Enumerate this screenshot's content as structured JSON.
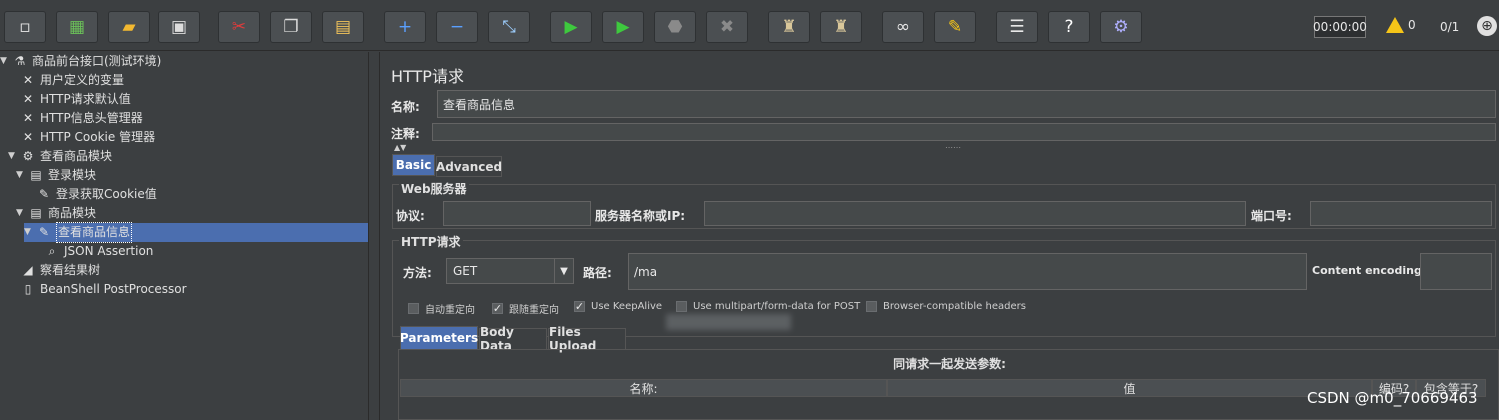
{
  "toolbar": {
    "buttons": [
      {
        "name": "new-icon",
        "glyph": "▫",
        "color": "#e8e8e8"
      },
      {
        "name": "templates-icon",
        "glyph": "▦",
        "color": "#6bbf59"
      },
      {
        "name": "open-icon",
        "glyph": "▰",
        "color": "#f2b830"
      },
      {
        "name": "save-icon",
        "glyph": "▣",
        "color": "#dcdcdc"
      },
      {
        "name": "cut-icon",
        "glyph": "✂",
        "color": "#e03c3c"
      },
      {
        "name": "copy-icon",
        "glyph": "❐",
        "color": "#dcdcdc"
      },
      {
        "name": "paste-icon",
        "glyph": "▤",
        "color": "#f2c45a"
      },
      {
        "name": "expand-icon",
        "glyph": "+",
        "color": "#5aa0ff"
      },
      {
        "name": "collapse-icon",
        "glyph": "−",
        "color": "#5aa0ff"
      },
      {
        "name": "toggle-icon",
        "glyph": "⤡",
        "color": "#9ecfff"
      },
      {
        "name": "start-icon",
        "glyph": "▶",
        "color": "#3ec93e"
      },
      {
        "name": "start-no-pause-icon",
        "glyph": "▶",
        "color": "#3ec93e"
      },
      {
        "name": "stop-icon",
        "glyph": "⬣",
        "color": "#8a8a8a"
      },
      {
        "name": "shutdown-icon",
        "glyph": "✖",
        "color": "#8a8a8a"
      },
      {
        "name": "clear-icon",
        "glyph": "♜",
        "color": "#d9c79a"
      },
      {
        "name": "clear-all-icon",
        "glyph": "♜",
        "color": "#d9c79a"
      },
      {
        "name": "search-icon",
        "glyph": "∞",
        "color": "#e8e8e8"
      },
      {
        "name": "reset-search-icon",
        "glyph": "✎",
        "color": "#f5c518"
      },
      {
        "name": "function-helper-icon",
        "glyph": "☰",
        "color": "#e8e8e8"
      },
      {
        "name": "help-icon",
        "glyph": "?",
        "color": "#ffffff"
      },
      {
        "name": "remote-icon",
        "glyph": "⚙",
        "color": "#b0b0ff"
      }
    ],
    "timer": "00:00:00",
    "warnings": "0",
    "threads": "0/1"
  },
  "tree": [
    {
      "name": "tree-item-test-plan",
      "label": "商品前台接口(测试环境)",
      "icon": "flask-icon",
      "glyph": "⚗",
      "toggle": "▼"
    },
    {
      "name": "tree-item-user-vars",
      "label": "用户定义的变量",
      "icon": "wrench-icon",
      "glyph": "✕",
      "toggle": ""
    },
    {
      "name": "tree-item-http-defaults",
      "label": "HTTP请求默认值",
      "icon": "wrench-icon",
      "glyph": "✕",
      "toggle": ""
    },
    {
      "name": "tree-item-header-manager",
      "label": "HTTP信息头管理器",
      "icon": "wrench-icon",
      "glyph": "✕",
      "toggle": ""
    },
    {
      "name": "tree-item-cookie-manager",
      "label": "HTTP Cookie 管理器",
      "icon": "wrench-icon",
      "glyph": "✕",
      "toggle": ""
    },
    {
      "name": "tree-item-thread-group",
      "label": "查看商品模块",
      "icon": "gear-icon",
      "glyph": "⚙",
      "toggle": "▼"
    },
    {
      "name": "tree-item-login-controller",
      "label": "登录模块",
      "icon": "controller-icon",
      "glyph": "▤",
      "toggle": "▼"
    },
    {
      "name": "tree-item-login-cookie",
      "label": "登录获取Cookie值",
      "icon": "pipette-icon",
      "glyph": "✎",
      "toggle": ""
    },
    {
      "name": "tree-item-goods-controller",
      "label": "商品模块",
      "icon": "controller-icon",
      "glyph": "▤",
      "toggle": "▼"
    },
    {
      "name": "tree-item-view-goods",
      "label": "查看商品信息",
      "icon": "pipette-icon",
      "glyph": "✎",
      "toggle": "▼"
    },
    {
      "name": "tree-item-json-assertion",
      "label": "JSON Assertion",
      "icon": "magnifier-icon",
      "glyph": "⌕",
      "toggle": ""
    },
    {
      "name": "tree-item-result-tree",
      "label": "察看结果树",
      "icon": "chart-icon",
      "glyph": "◢",
      "toggle": ""
    },
    {
      "name": "tree-item-beanshell",
      "label": "BeanShell PostProcessor",
      "icon": "document-icon",
      "glyph": "▯",
      "toggle": ""
    }
  ],
  "panel": {
    "title": "HTTP请求",
    "name_label": "名称:",
    "name_value": "查看商品信息",
    "comment_label": "注释:",
    "comment_value": "",
    "tabs": [
      "Basic",
      "Advanced"
    ],
    "web_server": {
      "title": "Web服务器",
      "protocol_label": "协议:",
      "protocol_value": "",
      "server_label": "服务器名称或IP:",
      "server_value": "",
      "port_label": "端口号:",
      "port_value": ""
    },
    "http_request": {
      "title": "HTTP请求",
      "method_label": "方法:",
      "method_value": "GET",
      "path_label": "路径:",
      "path_value": "/ma",
      "encoding_label": "Content encoding:",
      "encoding_value": ""
    },
    "checkboxes": [
      {
        "label": "自动重定向",
        "checked": false
      },
      {
        "label": "跟随重定向",
        "checked": true
      },
      {
        "label": "Use KeepAlive",
        "checked": true
      },
      {
        "label": "Use multipart/form-data for POST",
        "checked": false
      },
      {
        "label": "Browser-compatible headers",
        "checked": false
      }
    ],
    "sub_tabs": [
      "Parameters",
      "Body Data",
      "Files Upload"
    ],
    "params_header": "同请求一起发送参数:",
    "columns": [
      "名称:",
      "值",
      "编码?",
      "包含等于?"
    ]
  },
  "watermark": "CSDN @m0_70669463"
}
